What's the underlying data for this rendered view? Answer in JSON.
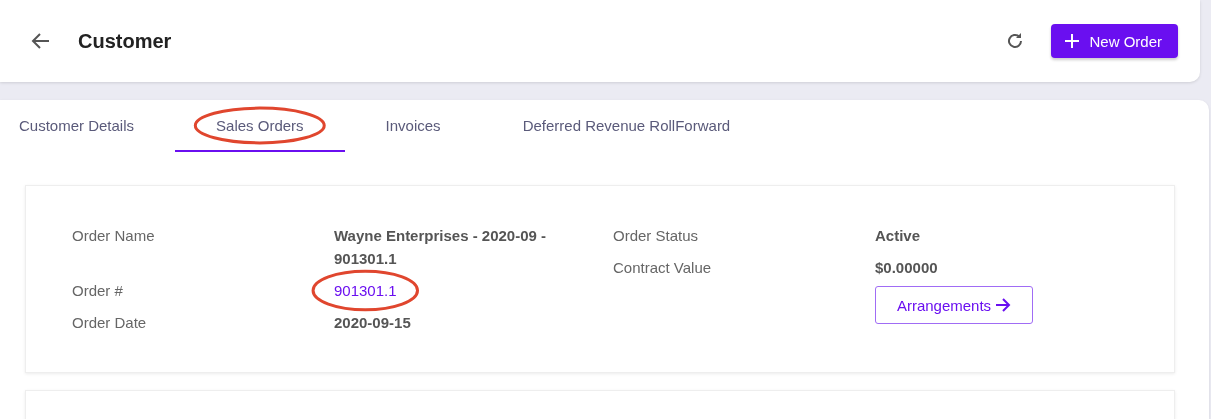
{
  "header": {
    "title": "Customer",
    "new_button": "New Order"
  },
  "tabs": [
    {
      "label": "Customer Details",
      "selected": false,
      "circled": false
    },
    {
      "label": "Sales Orders",
      "selected": true,
      "circled": true
    },
    {
      "label": "Invoices",
      "selected": false,
      "circled": false
    },
    {
      "label": "Deferred Revenue RollForward",
      "selected": false,
      "circled": false
    }
  ],
  "order": {
    "left_fields": [
      {
        "label": "Order Name",
        "value": "Wayne Enterprises - 2020-09 - 901301.1",
        "kind": "text",
        "circled": false
      },
      {
        "label": "Order #",
        "value": "901301.1",
        "kind": "link",
        "circled": true
      },
      {
        "label": "Order Date",
        "value": "2020-09-15",
        "kind": "text",
        "circled": false
      }
    ],
    "right_fields": [
      {
        "label": "Order Status",
        "value": "Active",
        "kind": "text",
        "circled": false
      },
      {
        "label": "Contract Value",
        "value": "$0.00000",
        "kind": "text",
        "circled": false
      }
    ],
    "button": "Arrangements"
  }
}
